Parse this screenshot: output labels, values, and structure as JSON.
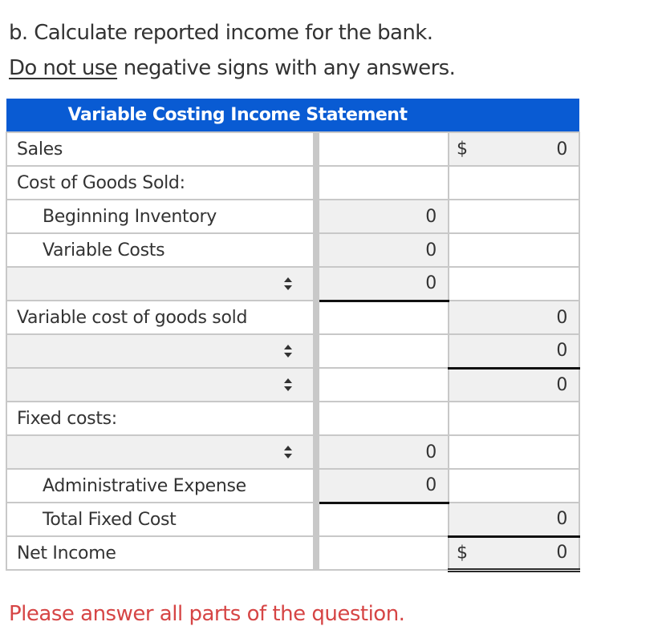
{
  "instructions": {
    "line1": "b. Calculate reported income for the bank.",
    "line2_underlined": "Do not use",
    "line2_rest": " negative signs with any answers."
  },
  "statement": {
    "title": "Variable Costing Income Statement",
    "rows": [
      {
        "label": "Sales",
        "indent": false,
        "col2": "",
        "col3": "0",
        "col3_dollar": "$"
      },
      {
        "label": "Cost of Goods Sold:",
        "indent": false,
        "col2": "",
        "col3": ""
      },
      {
        "label": "Beginning Inventory",
        "indent": true,
        "col2": "0",
        "col3": ""
      },
      {
        "label": "Variable Costs",
        "indent": true,
        "col2": "0",
        "col3": ""
      },
      {
        "label": "",
        "dropdown": true,
        "selected": "",
        "col2": "0",
        "col3": ""
      },
      {
        "label": "Variable cost of goods sold",
        "indent": false,
        "col2": "",
        "col3": "0"
      },
      {
        "label": "",
        "dropdown": true,
        "selected": "",
        "col2": "",
        "col3": "0"
      },
      {
        "label": "",
        "dropdown": true,
        "selected": "",
        "col2": "",
        "col3": "0"
      },
      {
        "label": "Fixed costs:",
        "indent": false,
        "col2": "",
        "col3": ""
      },
      {
        "label": "",
        "dropdown": true,
        "selected": "",
        "col2": "0",
        "col3": ""
      },
      {
        "label": "Administrative Expense",
        "indent": true,
        "col2": "0",
        "col3": ""
      },
      {
        "label": "Total Fixed Cost",
        "indent": true,
        "col2": "",
        "col3": "0"
      },
      {
        "label": "Net Income",
        "indent": false,
        "col2": "",
        "col3": "0",
        "col3_dollar": "$"
      }
    ]
  },
  "footer": {
    "warning": "Please answer all parts of the question."
  },
  "colors": {
    "header_bg": "#095bd3",
    "input_bg": "#f0f0f0",
    "warning": "#d64545"
  }
}
